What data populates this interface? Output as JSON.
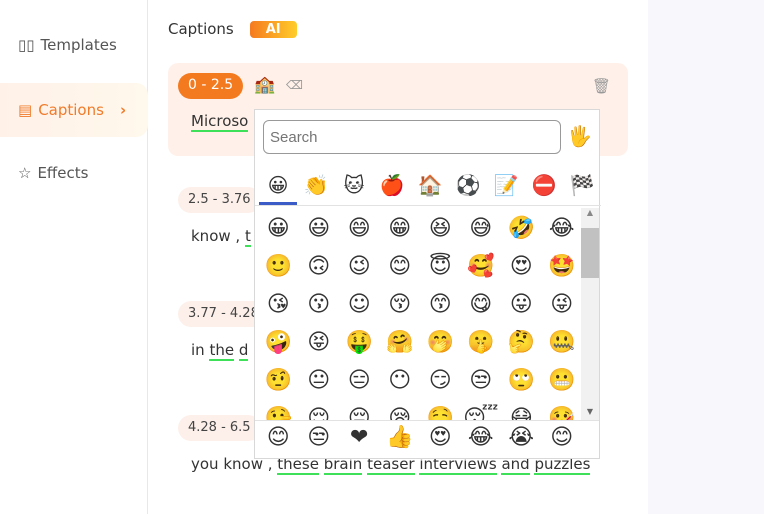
{
  "sidebar": {
    "items": [
      {
        "label": "Templates",
        "icon": "templates-icon"
      },
      {
        "label": "Captions",
        "icon": "document-icon",
        "active": true
      },
      {
        "label": "Effects",
        "icon": "sparkle-star-icon"
      }
    ]
  },
  "header": {
    "title": "Captions",
    "badge": "AI"
  },
  "captions": [
    {
      "time": "0 - 2.5",
      "text": "Microso",
      "emoji": "🏫"
    },
    {
      "time": "2.5 - 3.76",
      "text_plain": "know , ",
      "text_u": "t"
    },
    {
      "time": "3.77 - 4.28",
      "text_plain": "in ",
      "text_u1": "the",
      "text_u2": "d"
    },
    {
      "time": "4.28 - 6.5",
      "words_plain": "you know , ",
      "words": [
        "these",
        "brain",
        "teaser",
        "interviews",
        "and",
        "puzzles"
      ]
    }
  ],
  "picker": {
    "search_placeholder": "Search",
    "skin_tone": "🖐",
    "categories": [
      "😀",
      "👏",
      "🐱",
      "🍎",
      "🏠",
      "⚽",
      "📝",
      "⛔",
      "🏁"
    ],
    "emojis": [
      "😀",
      "😃",
      "😄",
      "😁",
      "😆",
      "😅",
      "🤣",
      "😂",
      "🙂",
      "🙃",
      "😉",
      "😊",
      "😇",
      "🥰",
      "😍",
      "🤩",
      "😘",
      "😗",
      "☺",
      "😚",
      "😙",
      "😋",
      "😛",
      "😜",
      "🤪",
      "😝",
      "🤑",
      "🤗",
      "🤭",
      "🤫",
      "🤔",
      "🤐",
      "🤨",
      "😐",
      "😑",
      "😶",
      "😏",
      "😒",
      "🙄",
      "😬",
      "🤥",
      "😌",
      "😔",
      "😪",
      "🤤",
      "😴",
      "😷",
      "🤒"
    ],
    "frequent": [
      "😊",
      "😒",
      "❤",
      "👍",
      "😍",
      "😂",
      "😭",
      "😊"
    ]
  },
  "colors": {
    "accent": "#f47a20",
    "underline": "#3ee05a",
    "tab_indicator": "#3b5bc6"
  }
}
